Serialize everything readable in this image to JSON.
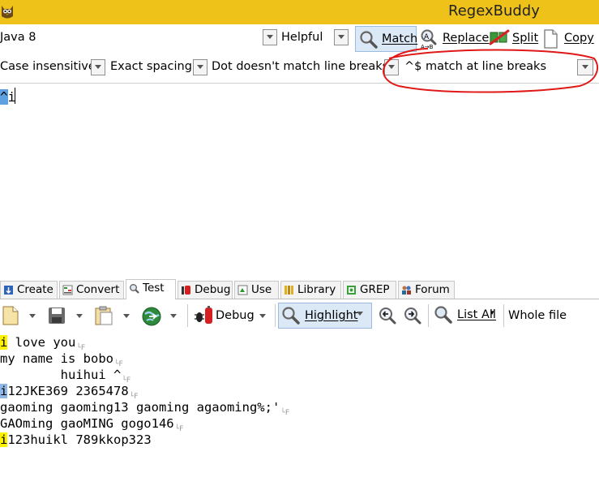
{
  "window": {
    "title": "RegexBuddy",
    "app_icon": "owl-icon"
  },
  "toolbar1": {
    "flavor": "Java 8",
    "help_mode": "Helpful",
    "buttons": [
      {
        "label": "Match",
        "icon": "magnifier-icon",
        "active": true
      },
      {
        "label": "Replace",
        "icon": "replace-icon"
      },
      {
        "label": "Split",
        "icon": "split-icon"
      },
      {
        "label": "Copy",
        "icon": "copy-icon"
      }
    ]
  },
  "options": {
    "case": "Case insensitive",
    "spacing": "Exact spacing",
    "dot": "Dot doesn't match line breaks",
    "anchors": "^$ match at line breaks"
  },
  "regex": {
    "selected": "^",
    "rest": "i"
  },
  "tabs": [
    {
      "label": "Create",
      "icon": "create-icon"
    },
    {
      "label": "Convert",
      "icon": "convert-icon"
    },
    {
      "label": "Test",
      "icon": "test-icon",
      "active": true
    },
    {
      "label": "Debug",
      "icon": "debug-icon"
    },
    {
      "label": "Use",
      "icon": "use-icon"
    },
    {
      "label": "Library",
      "icon": "library-icon"
    },
    {
      "label": "GREP",
      "icon": "grep-icon"
    },
    {
      "label": "Forum",
      "icon": "forum-icon"
    }
  ],
  "test_toolbar": {
    "debug_label": "Debug",
    "highlight_label": "Highlight",
    "list_all_label": "List All",
    "scope_label": "Whole file"
  },
  "test_lines": [
    {
      "match": "i",
      "match_style": "yellow",
      "rest": " love you"
    },
    {
      "match": "",
      "match_style": "",
      "rest": "my name is bobo"
    },
    {
      "match": "",
      "match_style": "",
      "rest": "        huihui ^"
    },
    {
      "match": "i",
      "match_style": "blue",
      "rest": "12JKE369 2365478"
    },
    {
      "match": "",
      "match_style": "",
      "rest": "gaoming gaoming13 gaoming agaoming%;'"
    },
    {
      "match": "",
      "match_style": "",
      "rest": "GAOming gaoMING gogo146"
    },
    {
      "match": "i",
      "match_style": "yellow",
      "rest": "123huikl 789kkop323",
      "eol": false
    }
  ],
  "colors": {
    "title_bar": "#efc21a",
    "highlight_yellow": "#fff200",
    "highlight_blue": "#8fb7e8",
    "annotation_red": "#e01818"
  }
}
